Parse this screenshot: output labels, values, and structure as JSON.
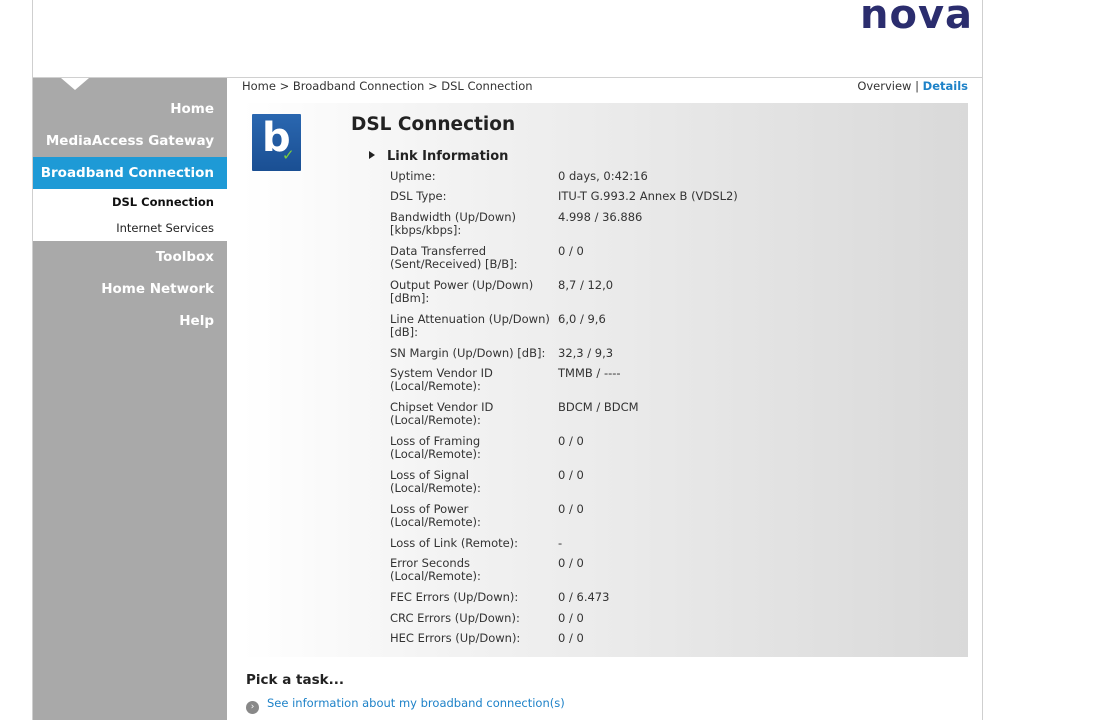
{
  "brand": {
    "logo_text": "nova"
  },
  "sidebar": {
    "items": [
      {
        "label": "Home"
      },
      {
        "label": "MediaAccess Gateway"
      },
      {
        "label": "Broadband Connection",
        "active": true
      },
      {
        "label": "Toolbox"
      },
      {
        "label": "Home Network"
      },
      {
        "label": "Help"
      }
    ],
    "subitems": [
      {
        "label": "DSL Connection",
        "current": true
      },
      {
        "label": "Internet Services"
      }
    ]
  },
  "breadcrumb": {
    "text": "Home > Broadband Connection > DSL Connection"
  },
  "view_links": {
    "overview": "Overview",
    "separator": "|",
    "details": "Details"
  },
  "page": {
    "title": "DSL Connection",
    "section": "Link Information"
  },
  "link_info": {
    "rows": [
      {
        "k1": "Uptime:",
        "k2": "",
        "v": "0 days, 0:42:16",
        "h": 20
      },
      {
        "k1": "DSL Type:",
        "k2": "",
        "v": "ITU-T G.993.2 Annex B (VDSL2)",
        "h": 21
      },
      {
        "k1": "Bandwidth (Up/Down)",
        "k2": "[kbps/kbps]:",
        "v": "4.998 / 36.886",
        "h": 34
      },
      {
        "k1": "Data Transferred",
        "k2": "(Sent/Received) [B/B]:",
        "v": "0 / 0",
        "h": 34
      },
      {
        "k1": "Output Power (Up/Down)",
        "k2": "[dBm]:",
        "v": "8,7 / 12,0",
        "h": 34
      },
      {
        "k1": "Line Attenuation (Up/Down)",
        "k2": "[dB]:",
        "v": "6,0 / 9,6",
        "h": 34
      },
      {
        "k1": "SN Margin (Up/Down) [dB]:",
        "k2": "",
        "v": "32,3 / 9,3",
        "h": 20
      },
      {
        "k1": "System Vendor ID",
        "k2": "(Local/Remote):",
        "v": "TMMB / ----",
        "h": 34
      },
      {
        "k1": "Chipset Vendor ID",
        "k2": "(Local/Remote):",
        "v": "BDCM / BDCM",
        "h": 34
      },
      {
        "k1": "Loss of Framing",
        "k2": "(Local/Remote):",
        "v": "0 / 0",
        "h": 34
      },
      {
        "k1": "Loss of Signal",
        "k2": "(Local/Remote):",
        "v": "0 / 0",
        "h": 34
      },
      {
        "k1": "Loss of Power",
        "k2": "(Local/Remote):",
        "v": "0 / 0",
        "h": 34
      },
      {
        "k1": "Loss of Link (Remote):",
        "k2": "",
        "v": "-",
        "h": 20
      },
      {
        "k1": "Error Seconds",
        "k2": "(Local/Remote):",
        "v": "0 / 0",
        "h": 34
      },
      {
        "k1": "FEC Errors (Up/Down):",
        "k2": "",
        "v": "0 / 6.473",
        "h": 21
      },
      {
        "k1": "CRC Errors (Up/Down):",
        "k2": "",
        "v": "0 / 0",
        "h": 20
      },
      {
        "k1": "HEC Errors (Up/Down):",
        "k2": "",
        "v": "0 / 0",
        "h": 20
      }
    ]
  },
  "tasks": {
    "title": "Pick a task...",
    "link": "See information about my broadband connection(s)"
  }
}
